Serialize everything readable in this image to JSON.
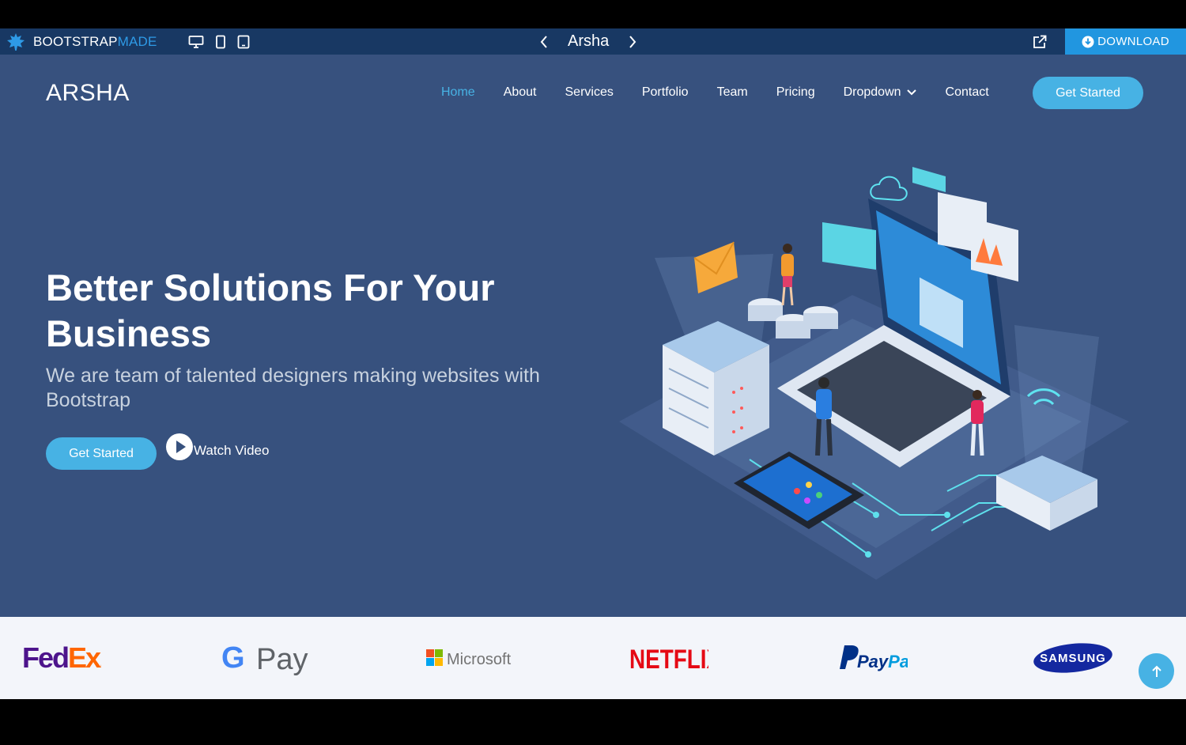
{
  "preview_bar": {
    "brand_main": "BOOTSTRAP",
    "brand_accent": "MADE",
    "template_title": "Arsha",
    "download_label": "DOWNLOAD",
    "icons": [
      "leaf-icon",
      "desktop-icon",
      "tablet-icon",
      "phone-icon",
      "chevron-left-icon",
      "chevron-right-icon",
      "external-link-icon",
      "download-icon"
    ]
  },
  "header": {
    "logo": "ARSHA",
    "nav": [
      {
        "label": "Home",
        "active": true
      },
      {
        "label": "About"
      },
      {
        "label": "Services"
      },
      {
        "label": "Portfolio"
      },
      {
        "label": "Team"
      },
      {
        "label": "Pricing"
      },
      {
        "label": "Dropdown",
        "has_dropdown": true
      },
      {
        "label": "Contact"
      }
    ],
    "cta": "Get Started"
  },
  "hero": {
    "headline": "Better Solutions For Your Business",
    "subheadline": "We are team of talented designers making websites with Bootstrap",
    "primary_button": "Get Started",
    "video_link": "Watch Video"
  },
  "clients": {
    "fedex": {
      "part1": "Fed",
      "part2": "Ex",
      "dot": "."
    },
    "gpay": {
      "g": "G",
      "pay": "Pay"
    },
    "microsoft": "Microsoft",
    "netflix": "NETFLIX",
    "paypal": {
      "pay": "Pay",
      "pal": "Pal"
    },
    "samsung": "SAMSUNG"
  },
  "colors": {
    "preview_bar": "#183863",
    "hero_bg": "#37517e",
    "accent": "#47b2e4",
    "download_bg": "#2196e0",
    "clients_bg": "#f3f5fa"
  }
}
